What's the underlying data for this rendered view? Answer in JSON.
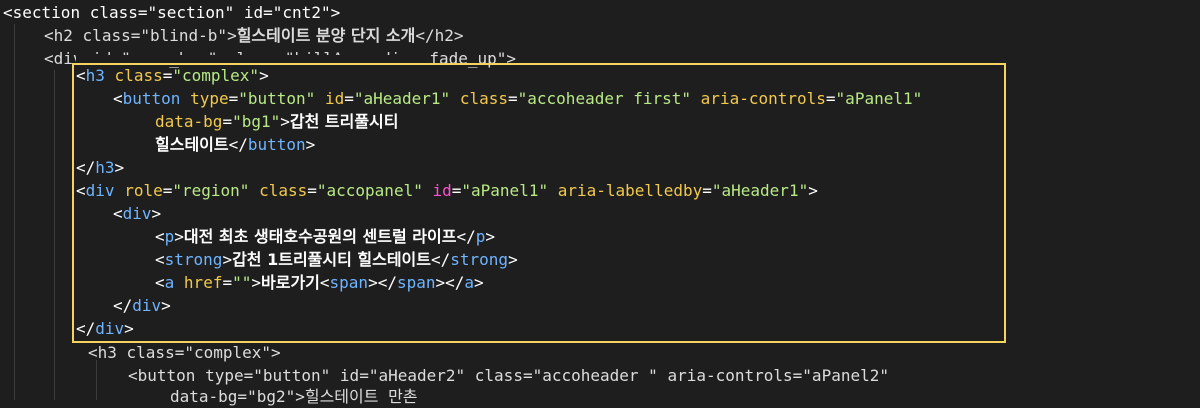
{
  "editor": {
    "highlight_color": "#f6d25f",
    "lines": [
      {
        "open": "<",
        "tag": "section",
        "a1": "class",
        "v1": "\"section\"",
        "a2": "id",
        "v2": "\"cnt2\"",
        "close": ">"
      },
      {
        "open": "<",
        "tag": "h2",
        "a1": "class",
        "v1": "\"blind-b\"",
        "close": ">",
        "text": "힐스테이트 분양 단지 소개",
        "end": "</h2>"
      },
      {
        "text": "<div id=\"acco_box\" class=\"hillAccordion fade_up\">"
      },
      {
        "open": "<",
        "tag": "h3",
        "a1": "class",
        "v1": "\"complex\"",
        "close": ">"
      },
      {
        "open": "<",
        "tag": "button",
        "a1": "type",
        "v1": "\"button\"",
        "a2": "id",
        "v2": "\"aHeader1\"",
        "a3": "class",
        "v3": "\"accoheader first\"",
        "a4": "aria-controls",
        "v4": "\"aPanel1\""
      },
      {
        "a1": "data-bg",
        "v1": "\"bg1\"",
        "close": ">",
        "text": "갑천 트리풀시티"
      },
      {
        "text": "힐스테이트",
        "end": "</button>"
      },
      {
        "end": "</h3>"
      },
      {
        "open": "<",
        "tag": "div",
        "a1": "role",
        "v1": "\"region\"",
        "a2": "class",
        "v2": "\"accopanel\"",
        "a3": "id",
        "v3": "\"aPanel1\"",
        "a4": "aria-labelledby",
        "v4": "\"aHeader1\"",
        "close": ">"
      },
      {
        "open": "<",
        "tag": "div",
        "close": ">"
      },
      {
        "open": "<",
        "tag": "p",
        "close": ">",
        "text": "대전 최초 생태호수공원의 센트럴 라이프",
        "end": "</p>"
      },
      {
        "open": "<",
        "tag": "strong",
        "close": ">",
        "text": "갑천 1트리풀시티 힐스테이트",
        "end": "</strong>"
      },
      {
        "open": "<",
        "tag": "a",
        "a1": "href",
        "v1": "\"\"",
        "close": ">",
        "text": "바로가기",
        "inner_open": "<span>",
        "inner_close": "</span>",
        "end": "</a>"
      },
      {
        "end": "</div>"
      },
      {
        "end": "</div>"
      },
      {
        "text": "<h3 class=\"complex\">"
      },
      {
        "text": "<button type=\"button\" id=\"aHeader2\" class=\"accoheader \" aria-controls=\"aPanel2\""
      },
      {
        "text": "data-bg=\"bg2\">힐스테이트 만촌"
      }
    ]
  }
}
